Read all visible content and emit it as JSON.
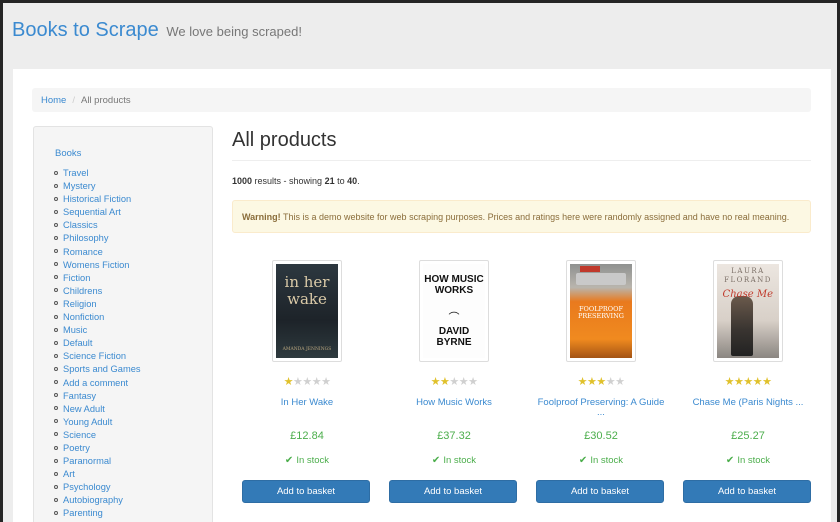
{
  "header": {
    "brand": "Books to Scrape",
    "tagline": "We love being scraped!"
  },
  "breadcrumb": {
    "home": "Home",
    "separator": "/",
    "current": "All products"
  },
  "sidebar": {
    "top_link": "Books",
    "categories": [
      "Travel",
      "Mystery",
      "Historical Fiction",
      "Sequential Art",
      "Classics",
      "Philosophy",
      "Romance",
      "Womens Fiction",
      "Fiction",
      "Childrens",
      "Religion",
      "Nonfiction",
      "Music",
      "Default",
      "Science Fiction",
      "Sports and Games",
      "Add a comment",
      "Fantasy",
      "New Adult",
      "Young Adult",
      "Science",
      "Poetry",
      "Paranormal",
      "Art",
      "Psychology",
      "Autobiography",
      "Parenting"
    ]
  },
  "main": {
    "title": "All products",
    "results": {
      "total": "1000",
      "text_1": " results - showing ",
      "from": "21",
      "text_2": " to ",
      "to": "40",
      "text_3": "."
    },
    "warning": {
      "strong": "Warning!",
      "text": " This is a demo website for web scraping purposes. Prices and ratings here were randomly assigned and have no real meaning."
    }
  },
  "products": [
    {
      "title": "In Her Wake",
      "rating": 1,
      "price": "£12.84",
      "stock": "In stock",
      "button": "Add to basket",
      "cover": {
        "title": "in her wake",
        "author": "AMANDA JENNINGS"
      }
    },
    {
      "title": "How Music Works",
      "rating": 2,
      "price": "£37.32",
      "stock": "In stock",
      "button": "Add to basket",
      "cover": {
        "title": "HOW MUSIC WORKS",
        "author": "DAVID BYRNE"
      }
    },
    {
      "title": "Foolproof Preserving: A Guide",
      "title_more": "...",
      "rating": 3,
      "price": "£30.52",
      "stock": "In stock",
      "button": "Add to basket",
      "cover": {
        "title": "FOOLPROOF PRESERVING"
      }
    },
    {
      "title": "Chase Me (Paris Nights ...",
      "rating": 5,
      "price": "£25.27",
      "stock": "In stock",
      "button": "Add to basket",
      "cover": {
        "title": "Chase Me",
        "author": "LAURA FLORAND"
      }
    }
  ],
  "colors": {
    "link": "#3b8ad0",
    "price": "#4cae4c",
    "star_on": "#e0c12b",
    "star_off": "#d0d0d0",
    "button": "#337ab7"
  }
}
